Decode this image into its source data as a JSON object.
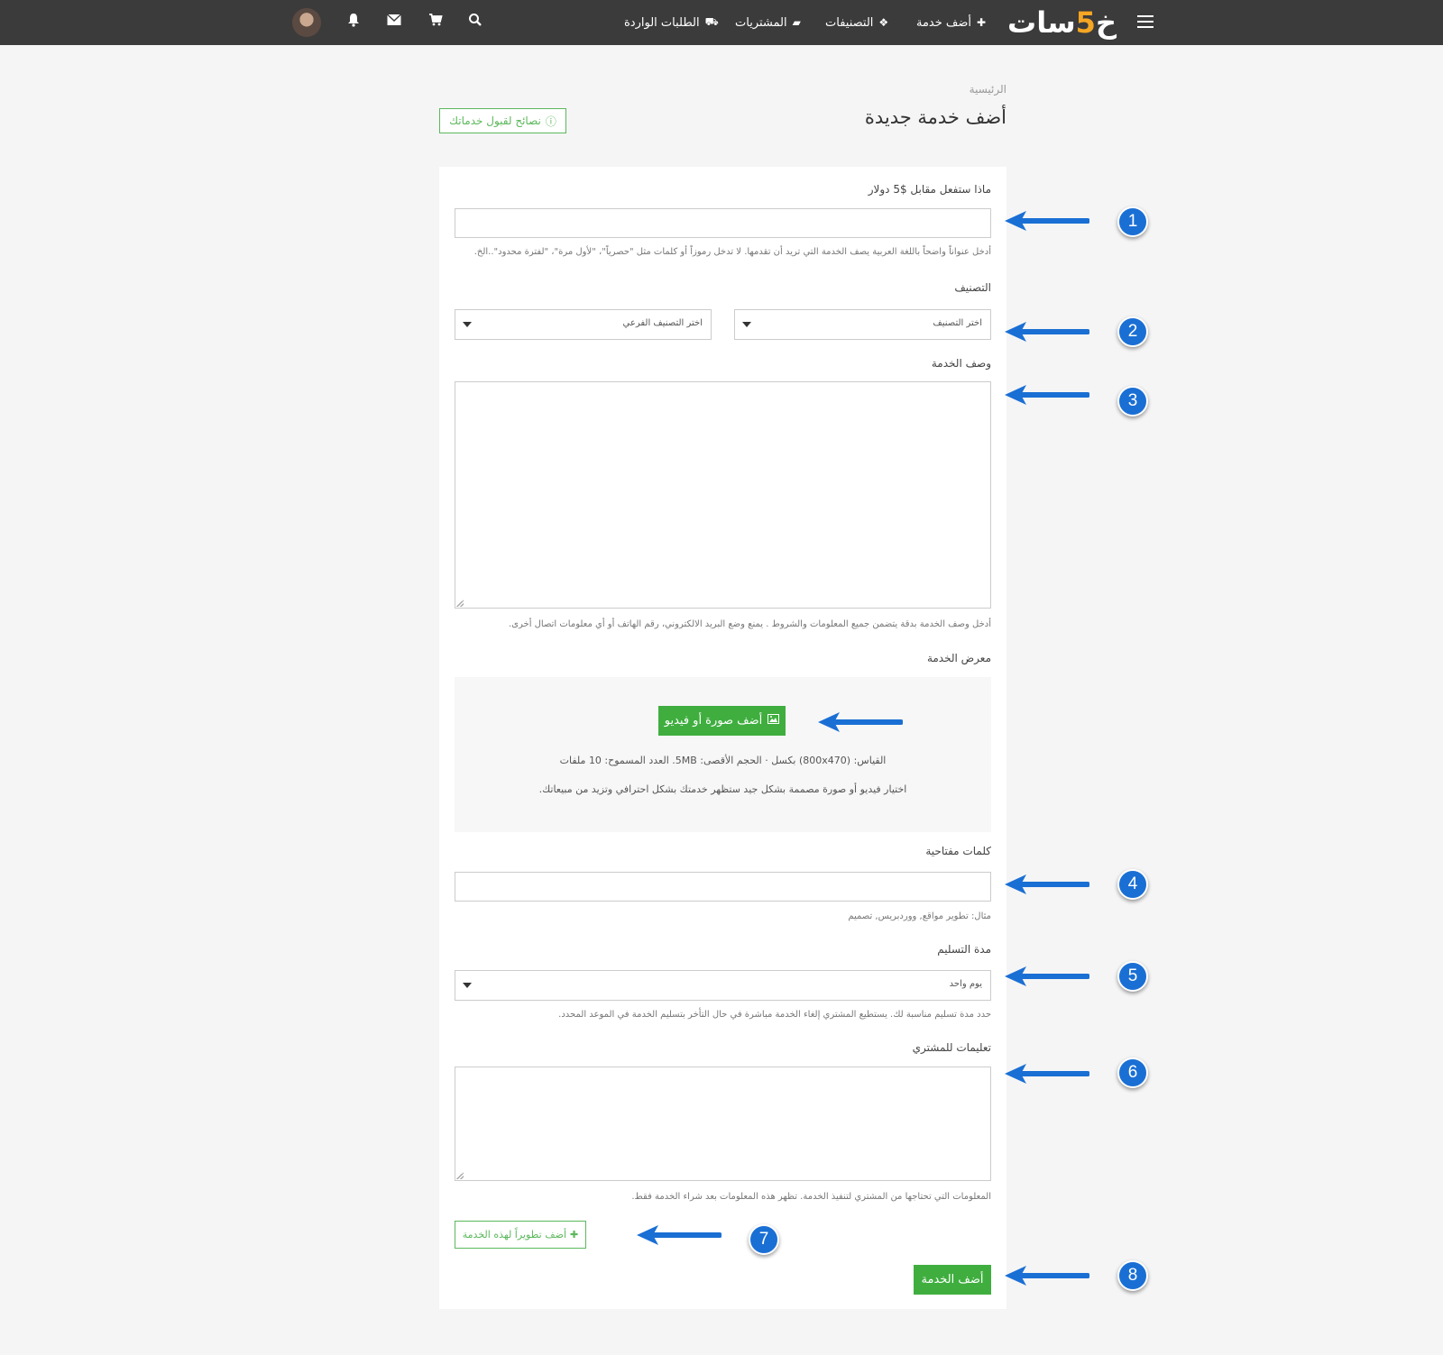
{
  "header": {
    "logo_text": "خمسات",
    "logo_prefix": "خ",
    "logo_five": "5",
    "logo_suffix": "سات",
    "nav": {
      "add_service": "أضف خدمة",
      "categories": "التصنيفات",
      "purchases": "المشتريات",
      "incoming_orders": "الطلبات الواردة"
    },
    "icons": [
      "menu-icon",
      "plus-icon",
      "categories-icon",
      "folder-icon",
      "truck-icon",
      "search-icon",
      "cart-icon",
      "envelope-icon",
      "bell-icon",
      "avatar"
    ]
  },
  "page": {
    "breadcrumb": "الرئيسية",
    "title": "أضف خدمة جديدة",
    "tips_button": "نصائح لقبول خدماتك"
  },
  "form": {
    "title_label": "ماذا ستفعل مقابل $5 دولار",
    "title_value": "",
    "title_help": "أدخل عنواناً واضحاً باللغة العربية يصف الخدمة التي تريد أن تقدمها. لا تدخل رموزاً أو كلمات مثل \"حصرياً\"، \"لأول مرة\"، \"لفترة محدود\"..الخ.",
    "category_label": "التصنيف",
    "category_select": "اختر التصنيف",
    "subcategory_select": "اختر التصنيف الفرعي",
    "description_label": "وصف الخدمة",
    "description_value": "",
    "description_help": "أدخل وصف الخدمة بدقة يتضمن جميع المعلومات والشروط . يمنع وضع البريد الالكتروني، رقم الهاتف أو أي معلومات اتصال أخرى.",
    "gallery_label": "معرض الخدمة",
    "gallery_button": "أضف صورة أو فيديو",
    "gallery_info": "القياس: (800x470) بكسل · الحجم الأقصى: 5MB. العدد المسموح: 10 ملفات",
    "gallery_tip": "اختيار فيديو أو صورة مصممة بشكل جيد ستظهر خدمتك بشكل احترافي وتزيد من مبيعاتك.",
    "keywords_label": "كلمات مفتاحية",
    "keywords_value": "",
    "keywords_help": "مثال: تطوير مواقع, ووردبريس, تصميم",
    "delivery_label": "مدة التسليم",
    "delivery_value": "يوم واحد",
    "delivery_help": "حدد مدة تسليم مناسبة لك. يستطيع المشتري إلغاء الخدمة مباشرة في حال التأخر بتسليم الخدمة في الموعد المحدد.",
    "instructions_label": "تعليمات للمشتري",
    "instructions_value": "",
    "instructions_help": "المعلومات التي تحتاجها من المشتري لتنفيذ الخدمة. تظهر هذه المعلومات بعد شراء الخدمة فقط.",
    "add_development_button": "أضف تطويراً لهذه الخدمة",
    "submit_button": "أضف الخدمة"
  },
  "annotations": {
    "color": "#1a6fd4",
    "badges": [
      "1",
      "2",
      "3",
      "4",
      "5",
      "6",
      "7",
      "8"
    ]
  }
}
